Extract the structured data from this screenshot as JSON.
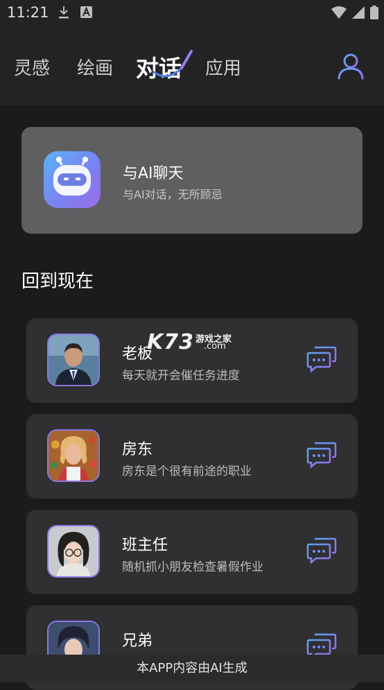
{
  "status": {
    "time": "11:21"
  },
  "nav": {
    "tabs": [
      {
        "label": "灵感"
      },
      {
        "label": "绘画"
      },
      {
        "label": "对话"
      },
      {
        "label": "应用"
      }
    ],
    "active_tab": "对话"
  },
  "feature": {
    "title": "与AI聊天",
    "subtitle": "与AI对话，无所顾忌"
  },
  "section_title": "回到现在",
  "characters": [
    {
      "name": "老板",
      "desc": "每天就开会催任务进度"
    },
    {
      "name": "房东",
      "desc": "房东是个很有前途的职业"
    },
    {
      "name": "班主任",
      "desc": "随机抓小朋友检查暑假作业"
    },
    {
      "name": "兄弟",
      "desc": ""
    }
  ],
  "watermark": {
    "brand": "K73",
    "tagline": "游戏之家",
    "domain": ".com"
  },
  "footer": "本APP内容由AI生成",
  "colors": {
    "accent": "#7b6ef2",
    "card": "#302f32",
    "feature_card": "#5f5e60"
  }
}
